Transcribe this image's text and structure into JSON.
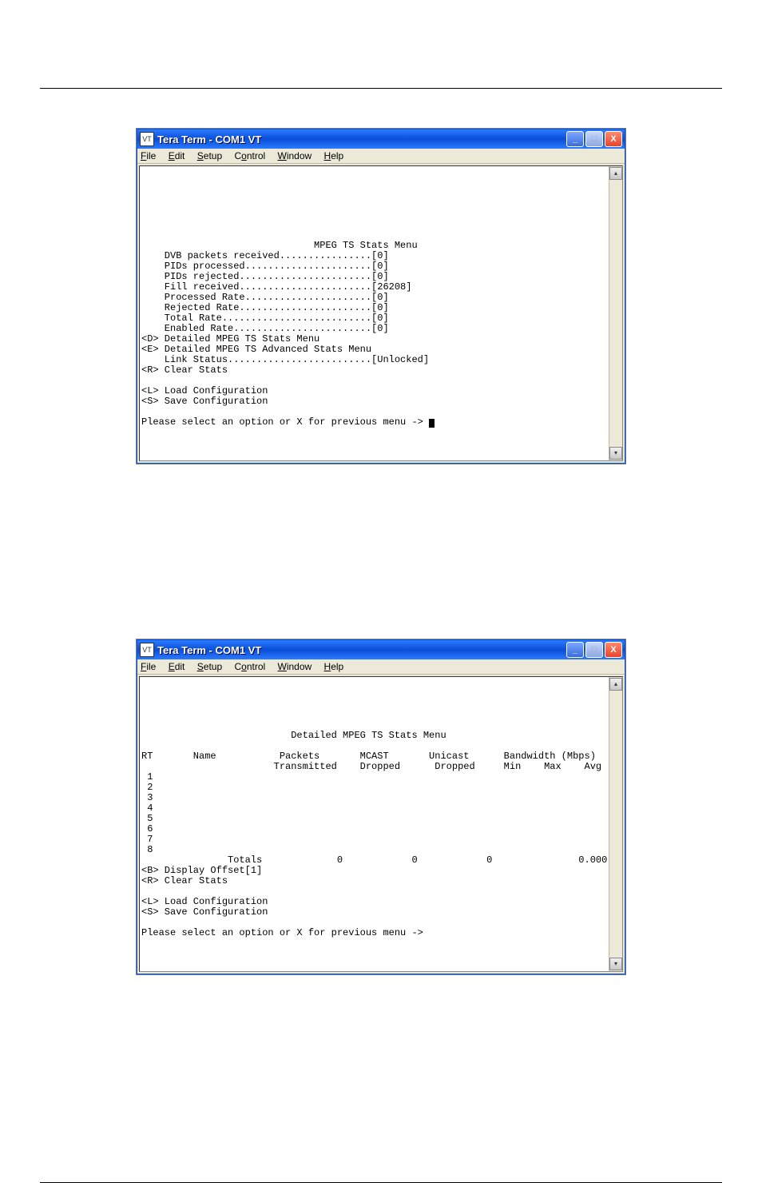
{
  "win1": {
    "title": "Tera Term - COM1 VT",
    "menus": [
      "File",
      "Edit",
      "Setup",
      "Control",
      "Window",
      "Help"
    ],
    "heading": "MPEG TS Stats Menu",
    "lines": [
      "    DVB packets received................[0]",
      "    PIDs processed......................[0]",
      "    PIDs rejected.......................[0]",
      "    Fill received.......................[26208]",
      "    Processed Rate......................[0]",
      "    Rejected Rate.......................[0]",
      "    Total Rate..........................[0]",
      "    Enabled Rate........................[0]",
      "<D> Detailed MPEG TS Stats Menu",
      "<E> Detailed MPEG TS Advanced Stats Menu",
      "    Link Status.........................[Unlocked]",
      "<R> Clear Stats",
      "",
      "<L> Load Configuration",
      "<S> Save Configuration"
    ],
    "prompt": "Please select an option or X for previous menu -> "
  },
  "win2": {
    "title": "Tera Term - COM1 VT",
    "menus": [
      "File",
      "Edit",
      "Setup",
      "Control",
      "Window",
      "Help"
    ],
    "heading": "Detailed MPEG TS Stats Menu",
    "header1": "RT       Name           Packets       MCAST       Unicast      Bandwidth (Mbps)",
    "header2": "                       Transmitted    Dropped      Dropped     Min    Max    Avg",
    "rows": [
      " 1",
      " 2",
      " 3",
      " 4",
      " 5",
      " 6",
      " 7",
      " 8"
    ],
    "totals": "               Totals             0            0            0               0.000",
    "opts": [
      "<B> Display Offset[1]",
      "<R> Clear Stats",
      "",
      "<L> Load Configuration",
      "<S> Save Configuration"
    ],
    "prompt": "Please select an option or X for previous menu ->"
  }
}
